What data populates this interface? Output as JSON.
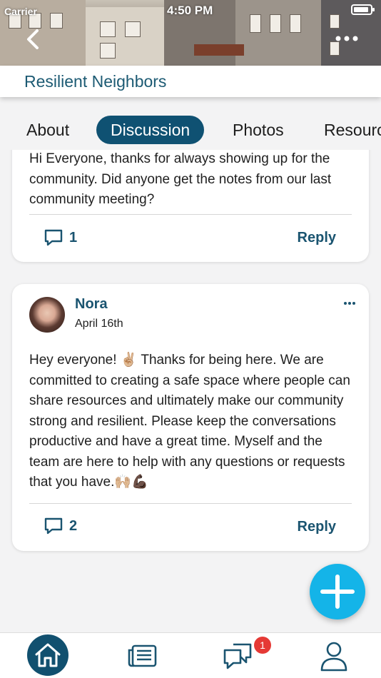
{
  "status_bar": {
    "carrier": "Carrier",
    "time": "4:50 PM"
  },
  "group": {
    "title": "Resilient Neighbors"
  },
  "tabs": [
    {
      "label": "About"
    },
    {
      "label": "Discussion",
      "active": true
    },
    {
      "label": "Photos"
    },
    {
      "label": "Resources"
    }
  ],
  "posts": [
    {
      "body_partial": "Hi Everyone, thanks for always showing up for the community. Did anyone get the notes from our last community meeting?",
      "comment_count": "1",
      "reply_label": "Reply"
    },
    {
      "author": "Nora",
      "date": "April 16th",
      "body": "Hey everyone! ✌🏼 Thanks for being here. We are committed to creating a safe space where people can share resources and ultimately make our community strong and resilient. Please keep the conversations productive and have a great time. Myself and the team are here to help with any questions or requests that you have.🙌🏼💪🏿",
      "comment_count": "2",
      "reply_label": "Reply"
    }
  ],
  "bottom_nav": {
    "items": [
      {
        "icon": "home-icon",
        "active": true
      },
      {
        "icon": "newspaper-icon"
      },
      {
        "icon": "chat-bubbles-icon",
        "badge": "1"
      },
      {
        "icon": "profile-icon"
      }
    ]
  },
  "colors": {
    "brand": "#0f5172",
    "accent": "#14b4e8",
    "badge": "#e53935"
  }
}
